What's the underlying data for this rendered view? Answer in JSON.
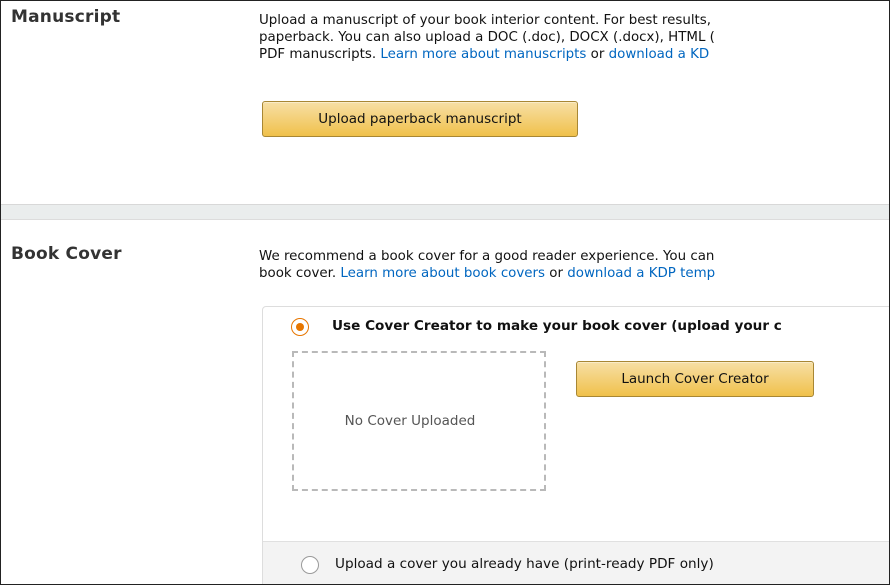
{
  "manuscript": {
    "heading": "Manuscript",
    "desc_line1": "Upload a manuscript of your book interior content. For best results,",
    "desc_line2": "paperback. You can also upload a DOC (.doc), DOCX (.docx), HTML (",
    "desc_line3_prefix": "PDF manuscripts. ",
    "learn_more_link": "Learn more about manuscripts",
    "or_text": " or ",
    "download_link": "download a KD",
    "upload_button": "Upload paperback manuscript"
  },
  "book_cover": {
    "heading": "Book Cover",
    "desc_line1": "We recommend a book cover for a good reader experience. You can",
    "desc_line2_prefix": "book cover. ",
    "learn_more_link": "Learn more about book covers",
    "or_text": " or ",
    "download_link": "download a KDP temp",
    "option_cover_creator": "Use Cover Creator to make your book cover (upload your c",
    "option_cover_creator_selected": true,
    "no_cover_text": "No Cover Uploaded",
    "launch_button": "Launch Cover Creator",
    "option_upload": "Upload a cover you already have (print-ready PDF only)"
  },
  "colors": {
    "link": "#0066c0",
    "button_yellow": "#f0c14b",
    "radio_selected": "#e77600",
    "section_gap": "#eaeded"
  }
}
